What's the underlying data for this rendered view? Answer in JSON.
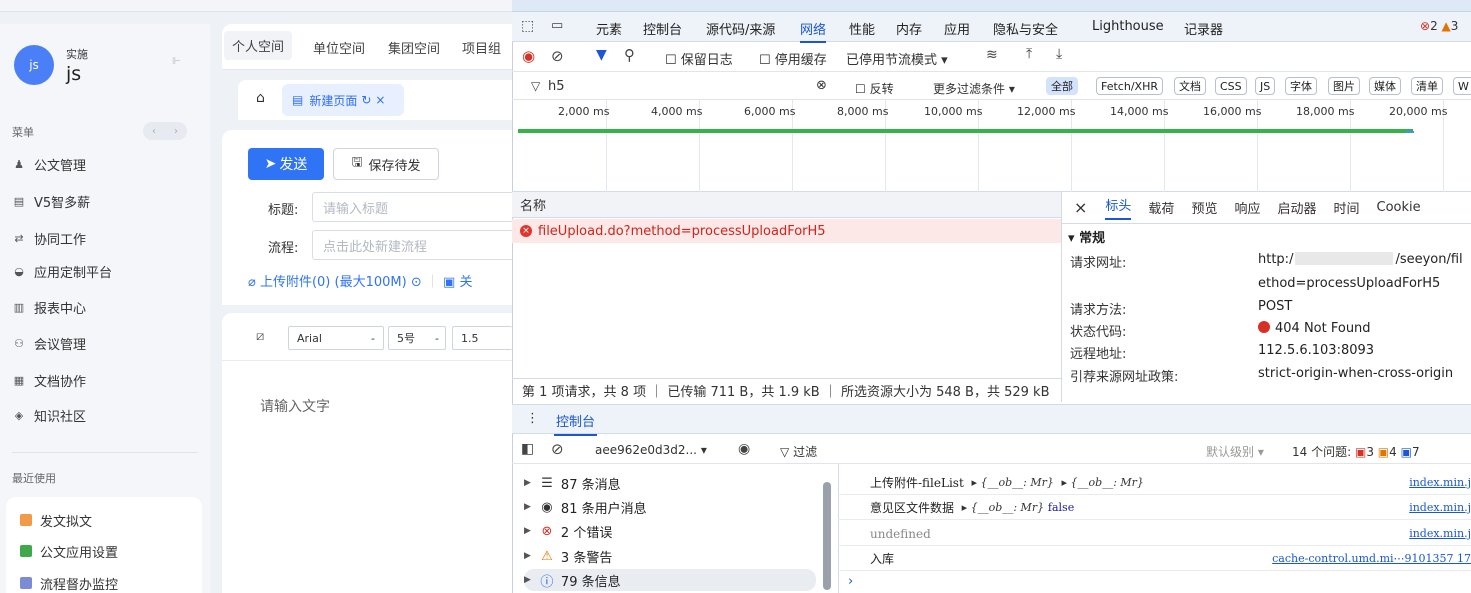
{
  "sidebar": {
    "avatar": "js",
    "role": "实施",
    "user": "js",
    "menu_title": "菜单",
    "menu": [
      {
        "icon": "user-icon",
        "glyph": "♟",
        "label": "公文管理"
      },
      {
        "icon": "document-icon",
        "glyph": "▤",
        "label": "V5智多薪"
      },
      {
        "icon": "flow-icon",
        "glyph": "⇄",
        "label": "协同工作"
      },
      {
        "icon": "app-platform-icon",
        "glyph": "◒",
        "label": "应用定制平台"
      },
      {
        "icon": "report-icon",
        "glyph": "▥",
        "label": "报表中心"
      },
      {
        "icon": "meeting-icon",
        "glyph": "⚇",
        "label": "会议管理"
      },
      {
        "icon": "doc-collab-icon",
        "glyph": "▦",
        "label": "文档协作"
      },
      {
        "icon": "knowledge-icon",
        "glyph": "◈",
        "label": "知识社区"
      }
    ],
    "recent_title": "最近使用",
    "recent": [
      {
        "label": "发文拟文",
        "color": "#f2994a"
      },
      {
        "label": "公文应用设置",
        "color": "#3fa84a"
      },
      {
        "label": "流程督办监控",
        "color": "#7b8bd6"
      }
    ]
  },
  "main": {
    "space_tabs": [
      "个人空间",
      "单位空间",
      "集团空间",
      "项目组"
    ],
    "page_tab": "新建页面",
    "send": "发送",
    "save_pending": "保存待发",
    "title_label": "标题:",
    "title_placeholder": "请输入标题",
    "flow_label": "流程:",
    "flow_placeholder": "点击此处新建流程",
    "attach": "上传附件(0) (最大100M)",
    "attach_more": "关",
    "font": "Arial",
    "size": "5号",
    "line_height": "1.5",
    "editor_placeholder": "请输入文字"
  },
  "devtools": {
    "tabs": [
      "元素",
      "控制台",
      "源代码/来源",
      "网络",
      "性能",
      "内存",
      "应用",
      "隐私与安全",
      "Lighthouse",
      "记录器"
    ],
    "active_tab": "网络",
    "errors": "2",
    "warnings": "3",
    "toolbar": {
      "preserve_log": "保留日志",
      "disable_cache": "停用缓存",
      "throttle": "已停用节流模式"
    },
    "filter": {
      "value": "h5",
      "invert": "反转",
      "more": "更多过滤条件",
      "chips": [
        "全部",
        "Fetch/XHR",
        "文档",
        "CSS",
        "JS",
        "字体",
        "图片",
        "媒体",
        "清单",
        "W"
      ]
    },
    "timeline": [
      "2,000 ms",
      "4,000 ms",
      "6,000 ms",
      "8,000 ms",
      "10,000 ms",
      "12,000 ms",
      "14,000 ms",
      "16,000 ms",
      "18,000 ms",
      "20,000 ms"
    ],
    "name_header": "名称",
    "request": "fileUpload.do?method=processUploadForH5",
    "detail_tabs": [
      "标头",
      "载荷",
      "预览",
      "响应",
      "启动器",
      "时间",
      "Cookie"
    ],
    "general": "常规",
    "headers": [
      {
        "k": "请求网址:",
        "v": "http:/",
        "v2": "/seeyon/fil",
        "v3": "ethod=processUploadForH5"
      },
      {
        "k": "请求方法:",
        "v": "POST"
      },
      {
        "k": "状态代码:",
        "v": "404 Not Found"
      },
      {
        "k": "远程地址:",
        "v": "112.5.6.103:8093"
      },
      {
        "k": "引荐来源网址政策:",
        "v": "strict-origin-when-cross-origin"
      }
    ],
    "summary": "第 1 项请求，共 8 项 ｜ 已传输 711 B，共 1.9 kB ｜ 所选资源大小为 548 B，共 529 kB",
    "drawer_tab": "控制台",
    "console": {
      "context": "aee962e0d3d2...",
      "filter": "过滤",
      "level": "默认级别",
      "issues": "14 个问题:",
      "issue_counts": [
        "3",
        "4",
        "7"
      ],
      "side": [
        {
          "icon": "list-icon",
          "glyph": "☰",
          "label": "87 条消息",
          "color": "#333"
        },
        {
          "icon": "user-circle-icon",
          "glyph": "◉",
          "label": "81 条用户消息",
          "color": "#333"
        },
        {
          "icon": "error-circle-icon",
          "glyph": "⊗",
          "label": "2 个错误",
          "color": "#d93025"
        },
        {
          "icon": "warning-icon",
          "glyph": "⚠",
          "label": "3 条警告",
          "color": "#e37400"
        },
        {
          "icon": "info-icon",
          "glyph": "ⓘ",
          "label": "79 条信息",
          "color": "#1a56d6"
        }
      ],
      "logs": [
        {
          "text": "上传附件-fileList",
          "objs": [
            "{__ob__: Mr}",
            "{__ob__: Mr}"
          ],
          "src": "index.min.j"
        },
        {
          "text": "意见区文件数据",
          "objs": [
            "{__ob__: Mr}"
          ],
          "extra": "false",
          "src": "index.min.j"
        },
        {
          "text": "undefined",
          "src": "index.min.j"
        },
        {
          "text": "入库",
          "src": "cache-control.umd.mi⋯9101357 17"
        }
      ]
    }
  }
}
